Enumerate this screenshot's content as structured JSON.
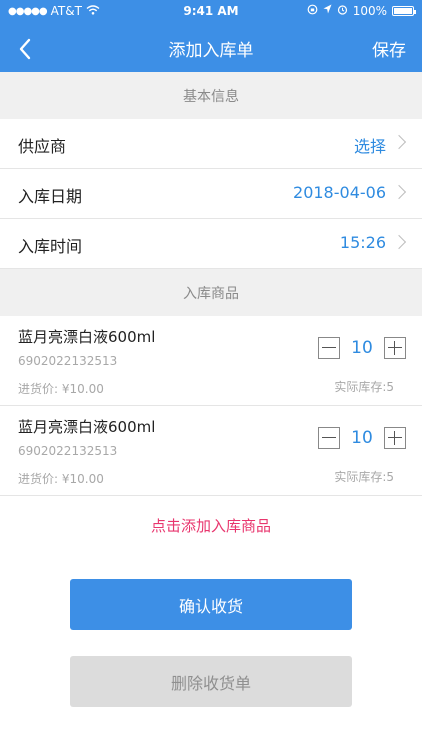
{
  "status_bar": {
    "carrier": "AT&T",
    "time": "9:41 AM",
    "battery": "100%"
  },
  "navbar": {
    "title": "添加入库单",
    "save_label": "保存",
    "back_icon": "chevron-left-icon"
  },
  "basic_info": {
    "section_title": "基本信息",
    "rows": [
      {
        "label": "供应商",
        "value": "选择"
      },
      {
        "label": "入库日期",
        "value": "2018-04-06"
      },
      {
        "label": "入库时间",
        "value": "15:26"
      }
    ]
  },
  "products_section": {
    "section_title": "入库商品",
    "items": [
      {
        "name": "蓝月亮漂白液600ml",
        "code": "6902022132513",
        "price": "进货价: ¥10.00",
        "quantity": "10",
        "stock": "实际库存:5"
      },
      {
        "name": "蓝月亮漂白液600ml",
        "code": "6902022132513",
        "price": "进货价: ¥10.00",
        "quantity": "10",
        "stock": "实际库存:5"
      }
    ],
    "add_link": "点击添加入库商品"
  },
  "actions": {
    "confirm_label": "确认收货",
    "delete_label": "删除收货单"
  },
  "colors": {
    "primary": "#3d8fe6",
    "value_text": "#2f8be0",
    "add_link": "#e8366e",
    "disabled_bg": "#dcdcdc"
  }
}
